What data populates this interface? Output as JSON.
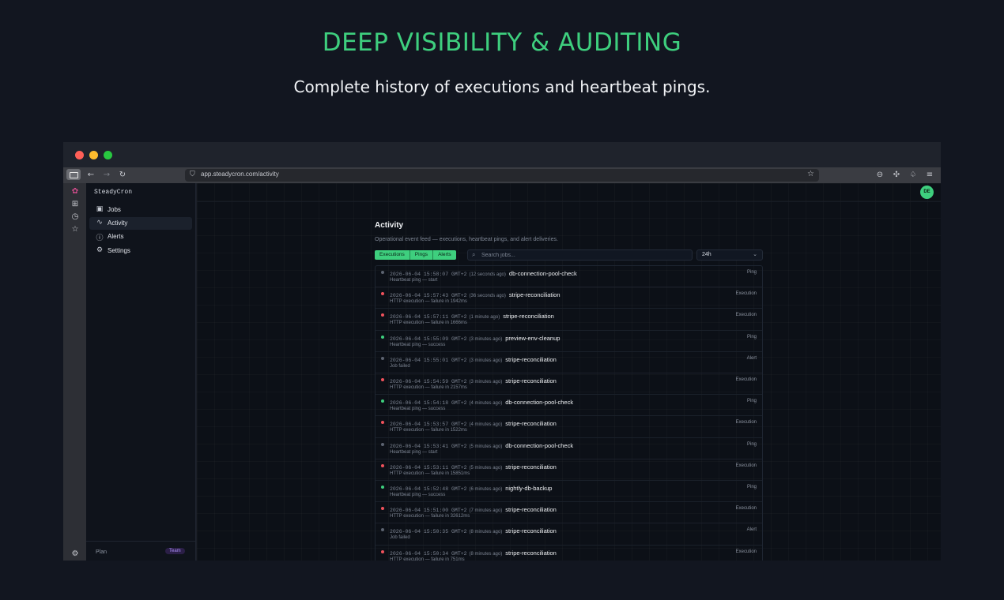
{
  "hero": {
    "title": "DEEP VISIBILITY & AUDITING",
    "subtitle": "Complete history of executions and heartbeat pings."
  },
  "browser": {
    "url": "app.steadycron.com/activity"
  },
  "sidebar": {
    "brand": "SteadyCron",
    "items": [
      {
        "label": "Jobs",
        "icon": "briefcase-icon",
        "active": false
      },
      {
        "label": "Activity",
        "icon": "activity-icon",
        "active": true
      },
      {
        "label": "Alerts",
        "icon": "alert-circle-icon",
        "active": false
      },
      {
        "label": "Settings",
        "icon": "gear-icon",
        "active": false
      }
    ],
    "plan_label": "Plan",
    "plan_badge": "Team"
  },
  "user": {
    "initials": "DE"
  },
  "activity": {
    "title": "Activity",
    "description": "Operational event feed — executions, heartbeat pings, and alert deliveries.",
    "filters": [
      "Executions",
      "Pings",
      "Alerts"
    ],
    "search_placeholder": "Search jobs...",
    "range": "24h",
    "colors": {
      "failure": "#f0525c",
      "success": "#3ecf7e",
      "neutral": "#5c6370",
      "accent": "#3ecf7e"
    },
    "rows": [
      {
        "ts": "2026-06-04 15:58:07 GMT+2",
        "rel": "(12 seconds ago)",
        "job": "db-connection-pool-check",
        "detail": "Heartbeat ping — start",
        "kind": "Ping",
        "status": "neutral"
      },
      {
        "ts": "2026-06-04 15:57:43 GMT+2",
        "rel": "(36 seconds ago)",
        "job": "stripe-reconciliation",
        "detail": "HTTP execution — failure in 1942ms",
        "kind": "Execution",
        "status": "failure"
      },
      {
        "ts": "2026-06-04 15:57:11 GMT+2",
        "rel": "(1 minute ago)",
        "job": "stripe-reconciliation",
        "detail": "HTTP execution — failure in 1666ms",
        "kind": "Execution",
        "status": "failure"
      },
      {
        "ts": "2026-06-04 15:55:09 GMT+2",
        "rel": "(3 minutes ago)",
        "job": "preview-env-cleanup",
        "detail": "Heartbeat ping — success",
        "kind": "Ping",
        "status": "success"
      },
      {
        "ts": "2026-06-04 15:55:01 GMT+2",
        "rel": "(3 minutes ago)",
        "job": "stripe-reconciliation",
        "detail": "Job failed",
        "kind": "Alert",
        "status": "neutral"
      },
      {
        "ts": "2026-06-04 15:54:59 GMT+2",
        "rel": "(3 minutes ago)",
        "job": "stripe-reconciliation",
        "detail": "HTTP execution — failure in 2157ms",
        "kind": "Execution",
        "status": "failure"
      },
      {
        "ts": "2026-06-04 15:54:18 GMT+2",
        "rel": "(4 minutes ago)",
        "job": "db-connection-pool-check",
        "detail": "Heartbeat ping — success",
        "kind": "Ping",
        "status": "success"
      },
      {
        "ts": "2026-06-04 15:53:57 GMT+2",
        "rel": "(4 minutes ago)",
        "job": "stripe-reconciliation",
        "detail": "HTTP execution — failure in 1522ms",
        "kind": "Execution",
        "status": "failure"
      },
      {
        "ts": "2026-06-04 15:53:41 GMT+2",
        "rel": "(5 minutes ago)",
        "job": "db-connection-pool-check",
        "detail": "Heartbeat ping — start",
        "kind": "Ping",
        "status": "neutral"
      },
      {
        "ts": "2026-06-04 15:53:11 GMT+2",
        "rel": "(5 minutes ago)",
        "job": "stripe-reconciliation",
        "detail": "HTTP execution — failure in 15851ms",
        "kind": "Execution",
        "status": "failure"
      },
      {
        "ts": "2026-06-04 15:52:48 GMT+2",
        "rel": "(6 minutes ago)",
        "job": "nightly-db-backup",
        "detail": "Heartbeat ping — success",
        "kind": "Ping",
        "status": "success"
      },
      {
        "ts": "2026-06-04 15:51:00 GMT+2",
        "rel": "(7 minutes ago)",
        "job": "stripe-reconciliation",
        "detail": "HTTP execution — failure in 32612ms",
        "kind": "Execution",
        "status": "failure"
      },
      {
        "ts": "2026-06-04 15:50:35 GMT+2",
        "rel": "(8 minutes ago)",
        "job": "stripe-reconciliation",
        "detail": "Job failed",
        "kind": "Alert",
        "status": "neutral"
      },
      {
        "ts": "2026-06-04 15:50:34 GMT+2",
        "rel": "(8 minutes ago)",
        "job": "stripe-reconciliation",
        "detail": "HTTP execution — failure in 751ms",
        "kind": "Execution",
        "status": "failure"
      }
    ]
  }
}
